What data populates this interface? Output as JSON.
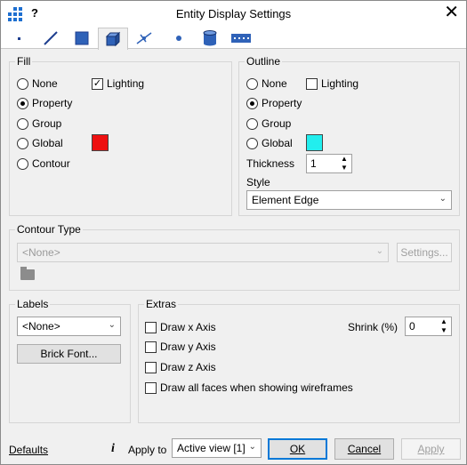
{
  "window": {
    "title": "Entity Display Settings",
    "help": "?",
    "close": "✕"
  },
  "toolbar": {
    "tabs": [
      "point-tab",
      "line-tab",
      "plate-tab",
      "brick-tab",
      "link-tab",
      "node-tab",
      "cylinder-tab",
      "beam-tab"
    ],
    "active": "brick-tab"
  },
  "fill": {
    "label": "Fill",
    "options": [
      "None",
      "Property",
      "Group",
      "Global",
      "Contour"
    ],
    "selected": "Property",
    "lighting_label": "Lighting",
    "lighting_checked": true,
    "global_color": "#ee1111"
  },
  "outline": {
    "label": "Outline",
    "options": [
      "None",
      "Property",
      "Group",
      "Global"
    ],
    "selected": "Property",
    "lighting_label": "Lighting",
    "lighting_checked": false,
    "global_color": "#22eeee",
    "thickness_label": "Thickness",
    "thickness_value": "1",
    "style_label": "Style",
    "style_value": "Element Edge"
  },
  "contour": {
    "label": "Contour Type",
    "value": "<None>",
    "settings_label": "Settings..."
  },
  "labels": {
    "label": "Labels",
    "value": "<None>",
    "font_button": "Brick Font..."
  },
  "extras": {
    "label": "Extras",
    "draw_x": "Draw x Axis",
    "draw_y": "Draw y Axis",
    "draw_z": "Draw z Axis",
    "draw_faces": "Draw all faces when showing wireframes",
    "shrink_label": "Shrink (%)",
    "shrink_value": "0"
  },
  "footer": {
    "defaults": "Defaults",
    "info": "i",
    "apply_to_label": "Apply to",
    "apply_to_value": "Active view [1]",
    "ok": "OK",
    "cancel": "Cancel",
    "apply": "Apply"
  }
}
